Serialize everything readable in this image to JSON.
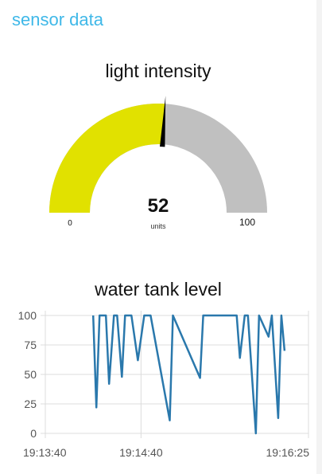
{
  "group": {
    "title": "sensor data"
  },
  "gauge": {
    "title": "light intensity",
    "value": 52,
    "value_text": "52",
    "units": "units",
    "min": 0,
    "max": 100,
    "min_label": "0",
    "max_label": "100",
    "fill_color": "#e1e100",
    "track_color": "#c0c0c0",
    "needle_color": "#000000"
  },
  "chart_data": {
    "type": "line",
    "title": "water tank level",
    "color": "#2a78ac",
    "ylim": [
      0,
      100
    ],
    "yticks": [
      "0",
      "25",
      "50",
      "75",
      "100"
    ],
    "xticks": [
      "19:13:40",
      "19:14:40",
      "19:16:25"
    ],
    "x_range": [
      "19:13:40",
      "19:16:25"
    ],
    "grid": true,
    "series": [
      {
        "x": [
          "19:14:10",
          "19:14:12",
          "19:14:14",
          "19:14:18",
          "19:14:20",
          "19:14:23",
          "19:14:25",
          "19:14:28",
          "19:14:30",
          "19:14:34",
          "19:14:38",
          "19:14:42",
          "19:14:46",
          "19:14:58",
          "19:15:00",
          "19:15:17",
          "19:15:19",
          "19:15:40",
          "19:15:42",
          "19:15:45",
          "19:15:47",
          "19:15:52",
          "19:15:54",
          "19:16:00",
          "19:16:02",
          "19:16:06",
          "19:16:08",
          "19:16:10"
        ],
        "y": [
          100,
          22,
          100,
          100,
          42,
          100,
          100,
          48,
          100,
          100,
          62,
          100,
          100,
          11,
          100,
          47,
          100,
          100,
          64,
          100,
          100,
          0,
          100,
          82,
          100,
          13,
          100,
          70
        ]
      }
    ]
  }
}
